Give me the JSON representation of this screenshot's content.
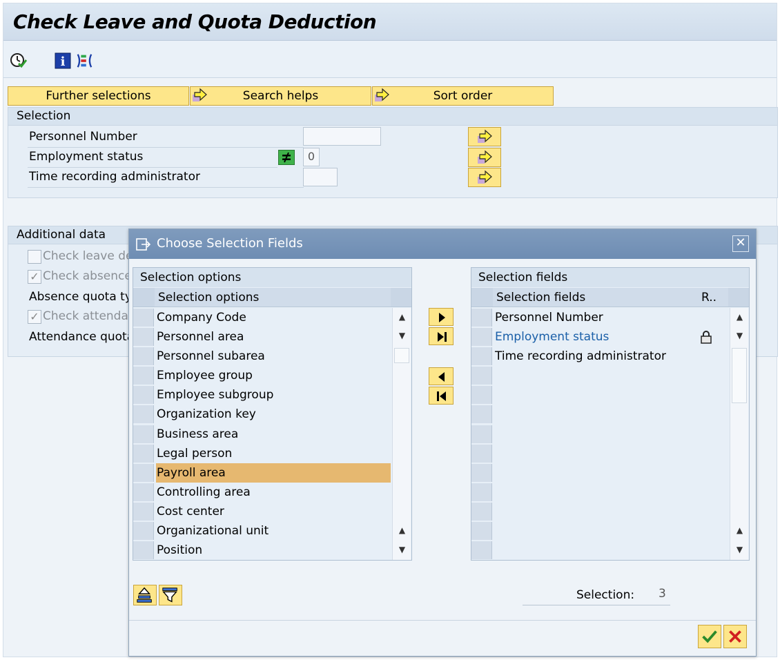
{
  "window": {
    "title": "Check Leave and Quota Deduction"
  },
  "toolbar": {
    "icons": [
      "execute-clock-icon",
      "info-icon",
      "selection-options-icon"
    ]
  },
  "selection_buttons": {
    "further_selections": "Further selections",
    "search_helps": "Search helps",
    "sort_order": "Sort order"
  },
  "selection_group": {
    "title": "Selection",
    "fields": [
      {
        "label": "Personnel Number",
        "value": ""
      },
      {
        "label": "Employment status",
        "value": "0",
        "operator_icon": "not-equal-icon"
      },
      {
        "label": "Time recording administrator",
        "value": ""
      }
    ]
  },
  "additional_group": {
    "title": "Additional data",
    "items": [
      {
        "label": "Check leave de",
        "checked": false
      },
      {
        "label": "Check absence",
        "checked": true
      },
      {
        "label": "Absence quota ty"
      },
      {
        "label": "Check attendar",
        "checked": true
      },
      {
        "label": "Attendance quota"
      }
    ]
  },
  "dialog": {
    "title": "Choose Selection Fields",
    "close_label": "✕",
    "left_panel": {
      "title": "Selection options",
      "column_header": "Selection options",
      "rows": [
        "Company Code",
        "Personnel area",
        "Personnel subarea",
        "Employee group",
        "Employee subgroup",
        "Organization key",
        "Business area",
        "Legal person",
        "Payroll area",
        "Controlling area",
        "Cost center",
        "Organizational unit",
        "Position"
      ],
      "highlighted_row": "Payroll area"
    },
    "right_panel": {
      "title": "Selection fields",
      "column_header": "Selection fields",
      "column_header_r": "R..",
      "rows": [
        {
          "label": "Personnel Number",
          "locked": false
        },
        {
          "label": "Employment status",
          "locked": true
        },
        {
          "label": "Time recording administrator",
          "locked": false
        }
      ],
      "link_color": "#1a5fa8"
    },
    "selection_label": "Selection:",
    "selection_count": "3"
  },
  "colors": {
    "button_yellow": "#fde68a",
    "highlight_row": "#e6b870",
    "title_blue": "#7f9bbd"
  }
}
